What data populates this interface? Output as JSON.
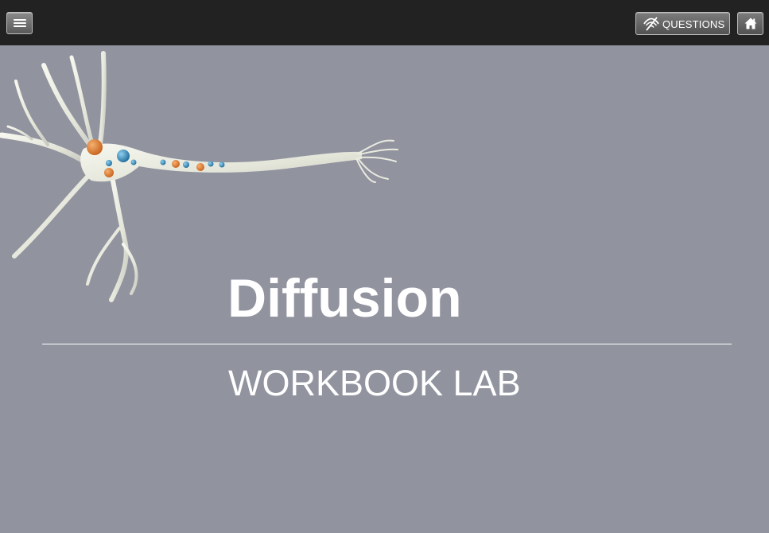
{
  "toolbar": {
    "menu_icon": "hamburger-menu-icon",
    "questions_label": "QUESTIONS",
    "questions_icon": "hidden-eye-icon",
    "home_icon": "home-icon"
  },
  "main": {
    "title": "Diffusion",
    "subtitle": "WORKBOOK LAB",
    "illustration": "neuron-illustration"
  },
  "colors": {
    "toolbar_bg": "#222222",
    "page_bg": "#91939f",
    "text": "#ffffff",
    "molecule_orange": "#d9742a",
    "molecule_blue": "#2f7fb0"
  }
}
